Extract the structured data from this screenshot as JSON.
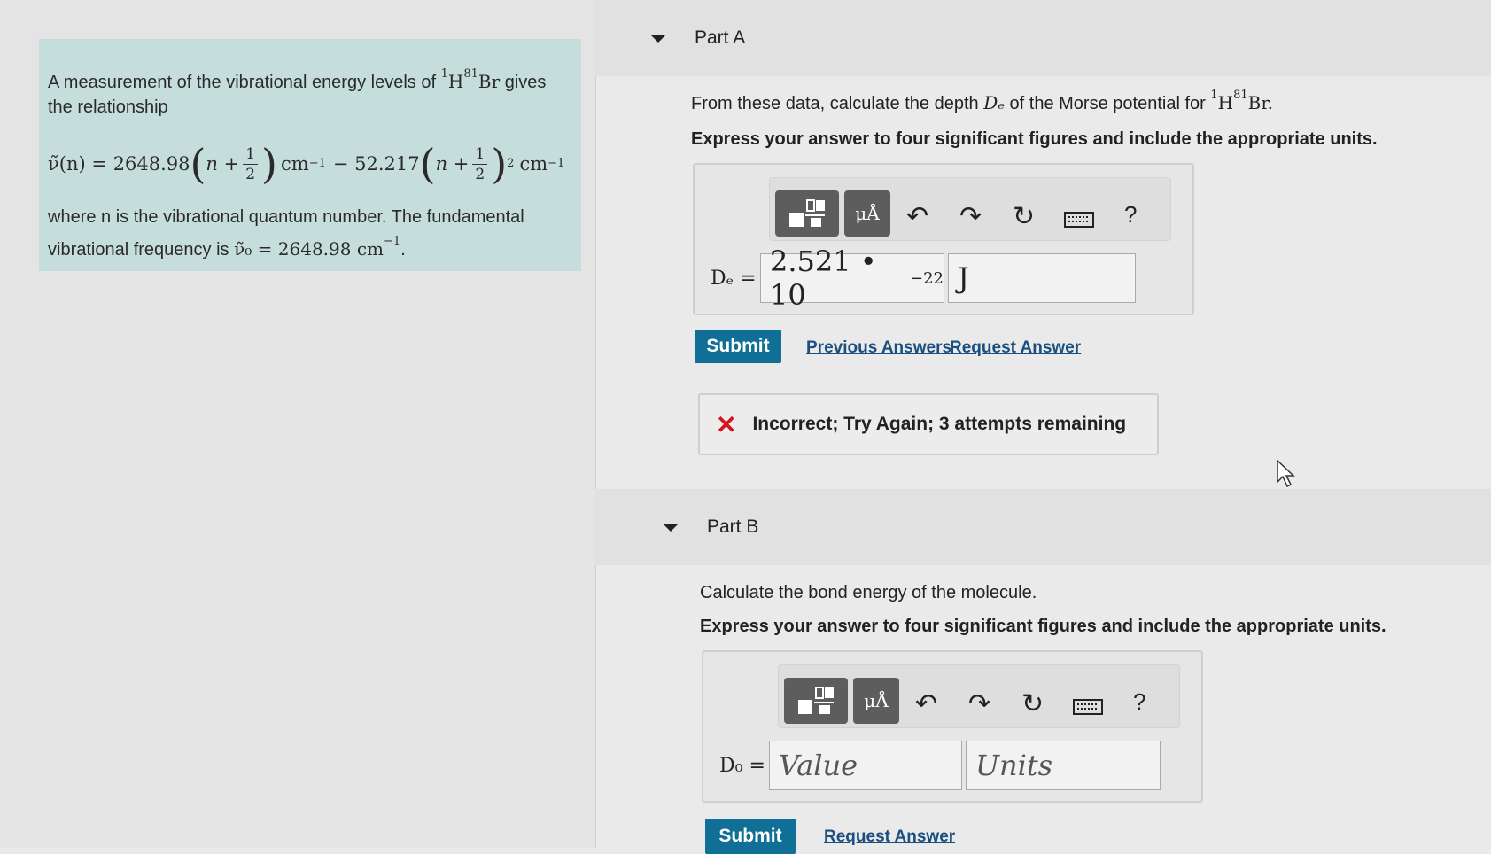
{
  "problem": {
    "intro_prefix": "A measurement of the vibrational energy levels of",
    "molecule_h_mass": "1",
    "molecule_h": "H",
    "molecule_br_mass": "81",
    "molecule_br": "Br",
    "intro_suffix": "gives the relationship",
    "eq_lhs": "ν̃(n) = 2648.98",
    "eq_n": "n +",
    "eq_frac_num": "1",
    "eq_frac_den": "2",
    "eq_unit": "cm",
    "eq_unit_exp": "−1",
    "eq_mid": "− 52.217",
    "eq_square": "2",
    "where_text": "where n is the vibrational quantum number. The fundamental vibrational frequency is",
    "fund_freq": "ν̃₀ = 2648.98 cm",
    "fund_freq_exp": "−1",
    "fund_freq_end": "."
  },
  "part_a": {
    "title": "Part A",
    "question_prefix": "From these data, calculate the depth",
    "question_symbol": "Dₑ",
    "question_mid": "of the Morse potential for",
    "question_molecule_h_mass": "1",
    "question_molecule_h": "H",
    "question_molecule_br_mass": "81",
    "question_molecule_br": "Br.",
    "instruction": "Express your answer to four significant figures and include the appropriate units.",
    "label": "Dₑ =",
    "value_mantissa": "2.521 • 10",
    "value_exp": "−22",
    "unit_value": "J",
    "submit": "Submit",
    "previous_answers": "Previous Answers",
    "request_answer": "Request Answer",
    "feedback_icon": "✕",
    "feedback": "Incorrect; Try Again; 3 attempts remaining"
  },
  "part_b": {
    "title": "Part B",
    "question": "Calculate the bond energy of the molecule.",
    "instruction": "Express your answer to four significant figures and include the appropriate units.",
    "label": "D₀ =",
    "value_placeholder": "Value",
    "units_placeholder": "Units",
    "submit": "Submit",
    "request_answer": "Request Answer"
  },
  "toolbar": {
    "units_label": "μÅ",
    "undo_icon": "↶",
    "redo_icon": "↷",
    "reset_icon": "↻",
    "help": "?"
  },
  "colors": {
    "problem_bg": "#c6dedb",
    "submit_bg": "#0f6f96",
    "error_red": "#d0151c",
    "link": "#1b4f80"
  }
}
